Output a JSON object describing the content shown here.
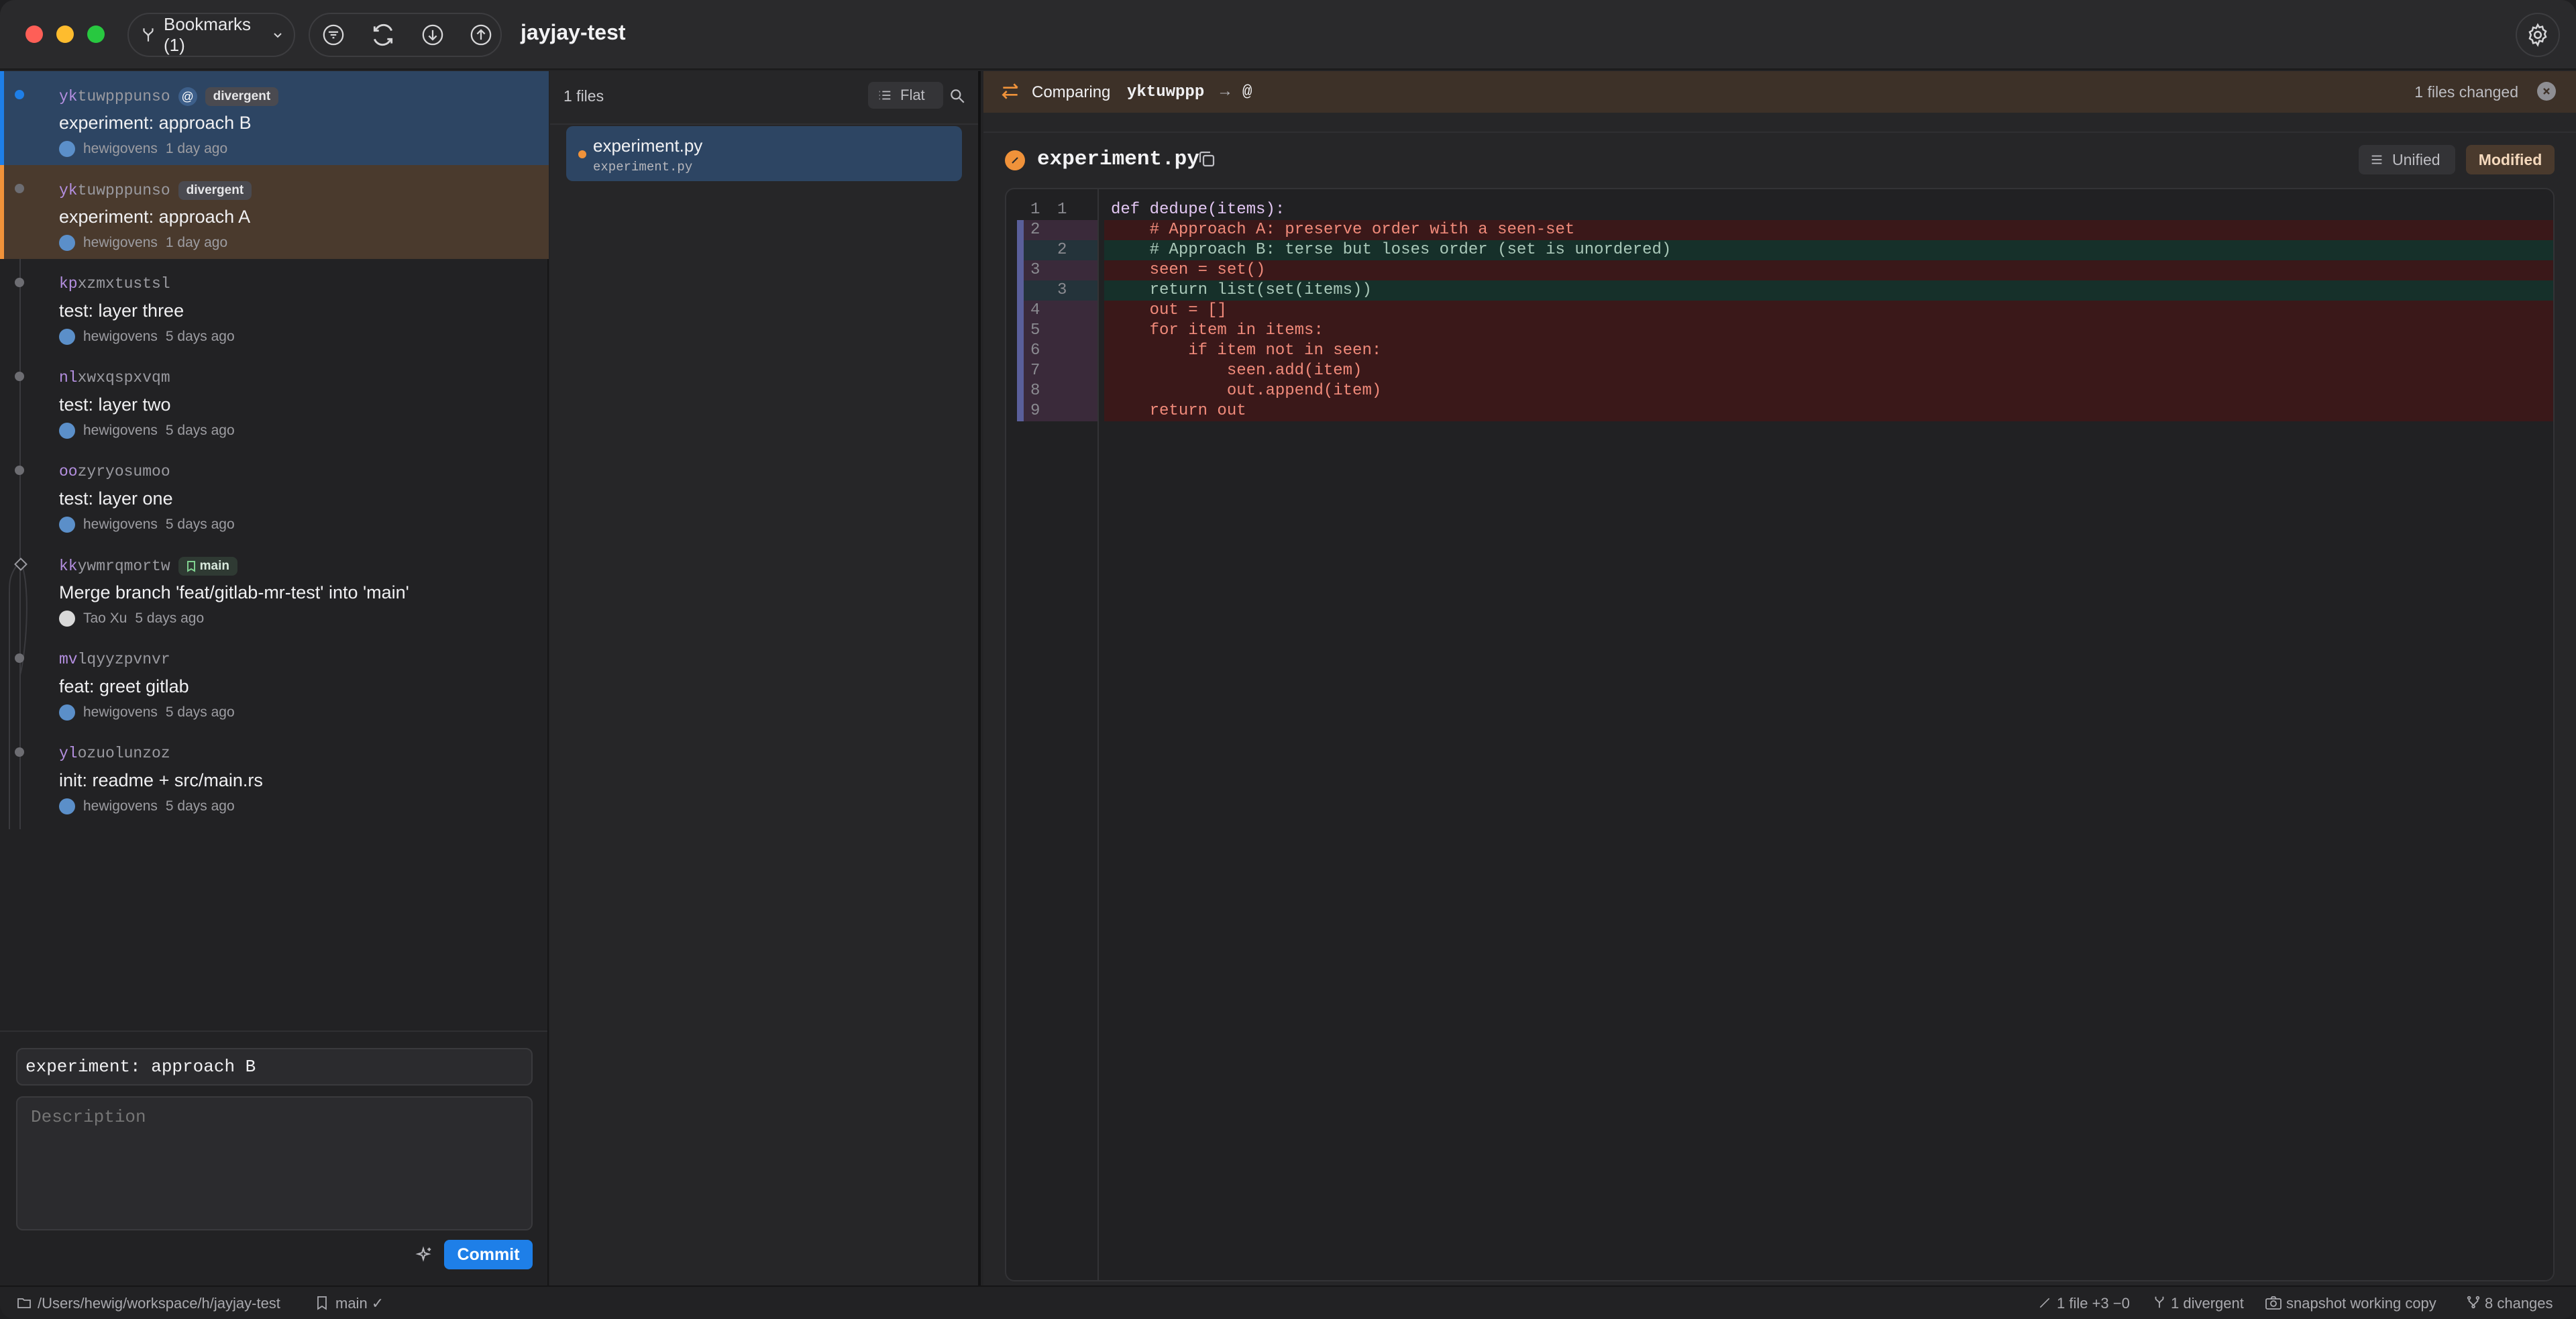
{
  "window": {
    "project": "jayjay-test"
  },
  "toolbar": {
    "bookmarks_label": "Bookmarks (1)"
  },
  "commits": [
    {
      "id_prefix": "yk",
      "id_rest": "tuwpppunso",
      "at": "@",
      "badge": "divergent",
      "message": "experiment: approach B",
      "author": "hewigovens",
      "time": "1 day ago",
      "selected": true
    },
    {
      "id_prefix": "yk",
      "id_rest": "tuwpppunso",
      "badge": "divergent",
      "message": "experiment: approach A",
      "author": "hewigovens",
      "time": "1 day ago"
    },
    {
      "id_prefix": "kp",
      "id_rest": "xzmxtustsl",
      "message": "test: layer three",
      "author": "hewigovens",
      "time": "5 days ago"
    },
    {
      "id_prefix": "nl",
      "id_rest": "xwxqspxvqm",
      "message": "test: layer two",
      "author": "hewigovens",
      "time": "5 days ago"
    },
    {
      "id_prefix": "oo",
      "id_rest": "zyryosumoo",
      "message": "test: layer one",
      "author": "hewigovens",
      "time": "5 days ago"
    },
    {
      "id_prefix": "kk",
      "id_rest": "ywmrqmortw",
      "bookmark": "main",
      "message": "Merge branch 'feat/gitlab-mr-test' into 'main'",
      "author": "Tao Xu",
      "time": "5 days ago"
    },
    {
      "id_prefix": "mv",
      "id_rest": "lqyyzpvnvr",
      "message": "feat: greet gitlab",
      "author": "hewigovens",
      "time": "5 days ago"
    },
    {
      "id_prefix": "yl",
      "id_rest": "ozuolunzoz",
      "message": "init: readme + src/main.rs",
      "author": "hewigovens",
      "time": "5 days ago"
    }
  ],
  "commit_form": {
    "title_value": "experiment: approach B",
    "description_placeholder": "Description",
    "commit_label": "Commit"
  },
  "files": {
    "count_label": "1 files",
    "view_label": "Flat",
    "items": [
      {
        "name": "experiment.py",
        "path": "experiment.py"
      }
    ]
  },
  "diff": {
    "comparing_label": "Comparing",
    "from": "yktuwppp",
    "arrow": "→",
    "to": "@",
    "changed_label": "1 files changed",
    "file_name": "experiment.py",
    "view_mode": "Unified",
    "status": "Modified",
    "lines": [
      {
        "type": "ctx",
        "old": "1",
        "new": "1",
        "text": "def dedupe(items):"
      },
      {
        "type": "del",
        "old": "2",
        "new": "",
        "text": "    # Approach A: preserve order with a seen-set"
      },
      {
        "type": "add",
        "old": "",
        "new": "2",
        "text": "    # Approach B: terse but loses order (set is unordered)"
      },
      {
        "type": "del",
        "old": "3",
        "new": "",
        "text": "    seen = set()"
      },
      {
        "type": "add",
        "old": "",
        "new": "3",
        "text": "    return list(set(items))"
      },
      {
        "type": "del",
        "old": "4",
        "new": "",
        "text": "    out = []"
      },
      {
        "type": "del",
        "old": "5",
        "new": "",
        "text": "    for item in items:"
      },
      {
        "type": "del",
        "old": "6",
        "new": "",
        "text": "        if item not in seen:"
      },
      {
        "type": "del",
        "old": "7",
        "new": "",
        "text": "            seen.add(item)"
      },
      {
        "type": "del",
        "old": "8",
        "new": "",
        "text": "            out.append(item)"
      },
      {
        "type": "del",
        "old": "9",
        "new": "",
        "text": "    return out"
      }
    ]
  },
  "statusbar": {
    "path": "/Users/hewig/workspace/h/jayjay-test",
    "branch": "main ✓",
    "changes_summary": "1 file +3 −0",
    "divergent": "1 divergent",
    "snapshot": "snapshot working copy",
    "changes": "8 changes"
  },
  "colors": {
    "accent": "#1e7fe8",
    "selected_row": "#2d4563",
    "divergent_row": "#4a3a2d",
    "del_bg": "#3a1819",
    "add_bg": "#16302a",
    "orange": "#f0923a"
  }
}
